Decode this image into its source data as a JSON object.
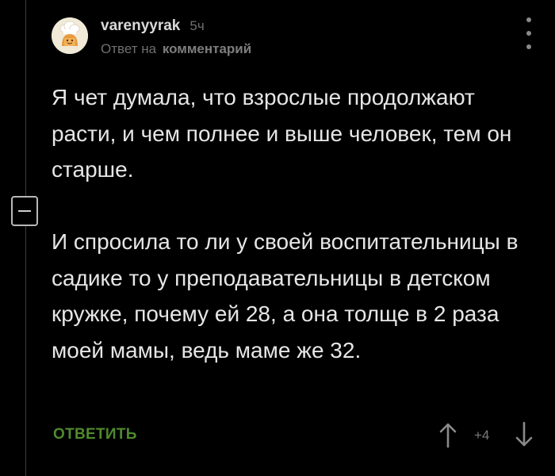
{
  "comment": {
    "author": "varenyyrak",
    "time": "5ч",
    "reply_prefix": "Ответ на",
    "reply_link": "комментарий",
    "paragraphs": [
      "Я чет думала, что взрослые продолжают расти, и чем полнее и выше человек, тем он старше.",
      "И спросила то ли у своей воспитательницы в садике то у преподавательницы в детском кружке, почему ей 28, а она толще в 2 раза моей мамы, ведь маме же 32."
    ],
    "reply_button": "ОТВЕТИТЬ",
    "rating": "+4"
  },
  "icons": {
    "more": "more-vertical-icon",
    "collapse": "minus-icon",
    "upvote": "arrow-up-icon",
    "downvote": "arrow-down-icon",
    "avatar": "chef-avatar"
  },
  "colors": {
    "background": "#000000",
    "text": "#e6e6e6",
    "muted": "#6f6f6f",
    "reply_green": "#4f8a2f",
    "thread_line": "#3c3c3c"
  }
}
